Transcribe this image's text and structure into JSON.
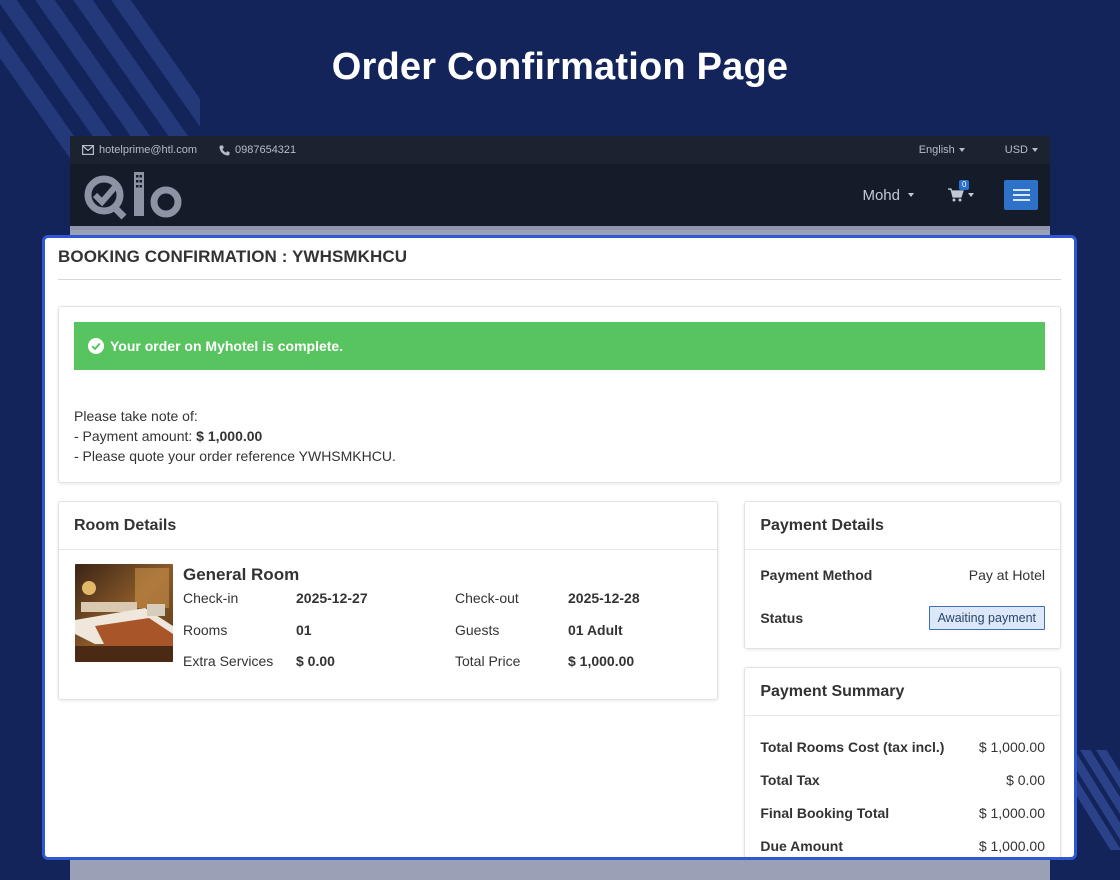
{
  "page": {
    "headline": "Order Confirmation Page"
  },
  "topbar": {
    "email": "hotelprime@htl.com",
    "phone": "0987654321",
    "language": "English",
    "currency": "USD"
  },
  "navbar": {
    "user": "Mohd",
    "cart_count": "0"
  },
  "booking": {
    "title": "BOOKING CONFIRMATION : YWHSMKHCU"
  },
  "order": {
    "success_message": "Your order on Myhotel is complete.",
    "note_intro": "Please take note of:",
    "payment_prefix": "- Payment amount: ",
    "payment_amount": "$ 1,000.00",
    "reference_line": "- Please quote your order reference YWHSMKHCU."
  },
  "room_details": {
    "heading": "Room Details",
    "room_name": "General Room",
    "fields": [
      {
        "label": "Check-in",
        "value": "2025-12-27"
      },
      {
        "label": "Check-out",
        "value": "2025-12-28"
      },
      {
        "label": "Rooms",
        "value": "01"
      },
      {
        "label": "Guests",
        "value": "01 Adult"
      },
      {
        "label": "Extra Services",
        "value": "$ 0.00"
      },
      {
        "label": "Total Price",
        "value": "$ 1,000.00"
      }
    ]
  },
  "payment_details": {
    "heading": "Payment Details",
    "method_label": "Payment Method",
    "method_value": "Pay at Hotel",
    "status_label": "Status",
    "status_value": "Awaiting payment"
  },
  "payment_summary": {
    "heading": "Payment Summary",
    "rows": [
      {
        "label": "Total Rooms Cost (tax incl.)",
        "value": "$ 1,000.00"
      },
      {
        "label": "Total Tax",
        "value": "$ 0.00"
      },
      {
        "label": "Final Booking Total",
        "value": "$ 1,000.00"
      },
      {
        "label": "Due Amount",
        "value": "$ 1,000.00"
      }
    ]
  },
  "colors": {
    "background": "#13245a",
    "success": "#57c45f",
    "accent": "#2f56d3",
    "navbar": "#141b29"
  }
}
